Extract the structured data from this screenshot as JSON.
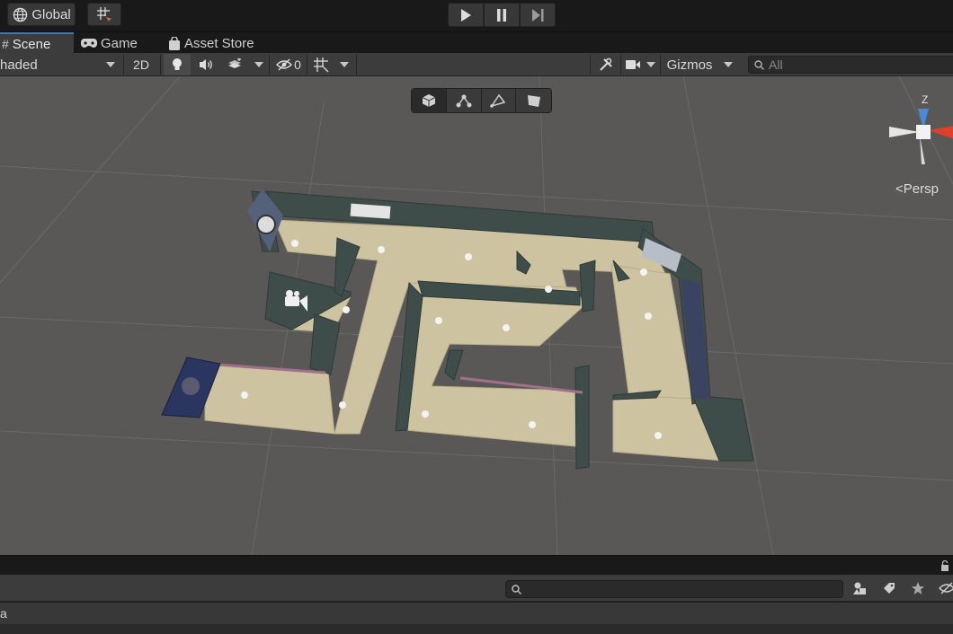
{
  "toolbar": {
    "global_label": "Global",
    "icons": [
      "globe-icon",
      "grid-snap-icon",
      "play-icon",
      "pause-icon",
      "step-icon"
    ]
  },
  "tabs": [
    {
      "label": "Scene",
      "icon": "scene-hash-icon",
      "active": true
    },
    {
      "label": "Game",
      "icon": "gamepad-icon",
      "active": false
    },
    {
      "label": "Asset Store",
      "icon": "shopping-bag-icon",
      "active": false
    }
  ],
  "scene_toolbar": {
    "draw_mode": "haded",
    "mode_2d": "2D",
    "hidden_count": "0",
    "gizmos_label": "Gizmos",
    "search_placeholder": "All"
  },
  "viewport": {
    "persp_label": "Persp",
    "axis_label": "Z",
    "background_color": "#5a5857",
    "floor_color": "#cdc3a0",
    "wall_color": "#3f4d4a"
  },
  "bottom_panel": {
    "list_text": "a"
  }
}
